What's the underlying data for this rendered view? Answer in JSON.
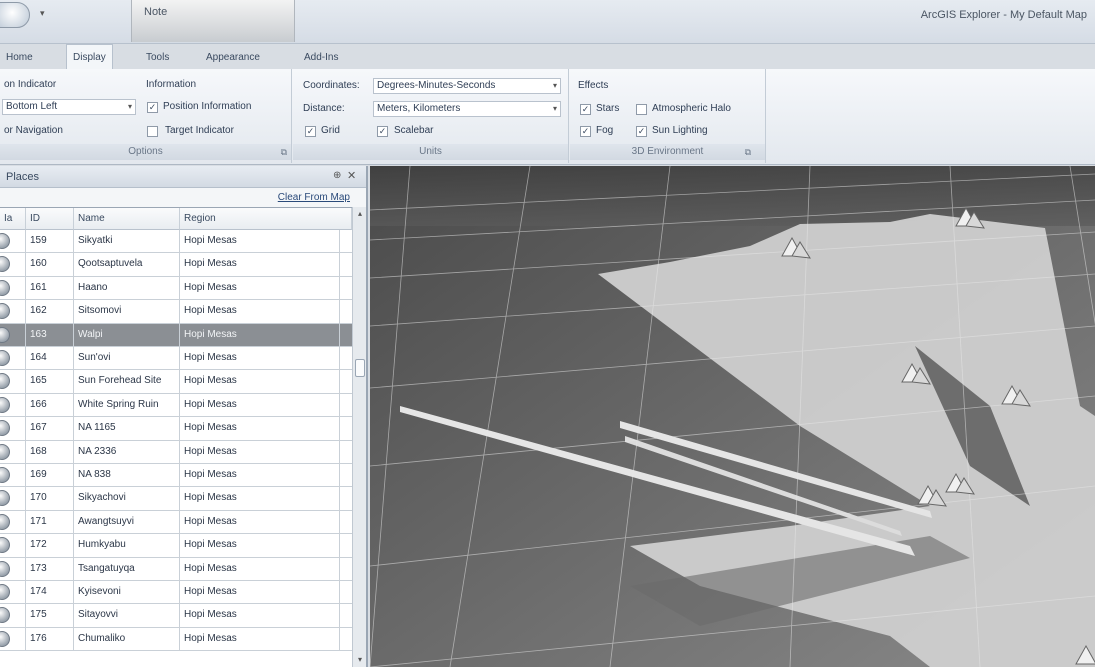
{
  "window": {
    "title": "ArcGIS Explorer - My Default Map"
  },
  "context_tab": "Note",
  "tabs": [
    "Home",
    "Display",
    "Tools",
    "Appearance",
    "Add-Ins"
  ],
  "active_tab": "Display",
  "ribbon": {
    "options": {
      "label": "Options",
      "partial_heading": "on Indicator",
      "combo_value": "Bottom Left",
      "partial_nav": "or Navigation",
      "info_heading": "Information",
      "position_info": {
        "label": "Position Information",
        "checked": true
      },
      "target_indicator": {
        "label": "Target Indicator",
        "checked": false
      }
    },
    "units": {
      "label": "Units",
      "coordinates_label": "Coordinates:",
      "coordinates_value": "Degrees-Minutes-Seconds",
      "distance_label": "Distance:",
      "distance_value": "Meters, Kilometers",
      "grid": {
        "label": "Grid",
        "checked": true
      },
      "scalebar": {
        "label": "Scalebar",
        "checked": true
      }
    },
    "environment": {
      "label": "3D Environment",
      "effects_heading": "Effects",
      "stars": {
        "label": "Stars",
        "checked": true
      },
      "atmospheric_halo": {
        "label": "Atmospheric Halo",
        "checked": false
      },
      "fog": {
        "label": "Fog",
        "checked": true
      },
      "sun_lighting": {
        "label": "Sun Lighting",
        "checked": true
      }
    }
  },
  "panel": {
    "title": "Places",
    "clear_link": "Clear From Map",
    "columns": [
      "ID",
      "Name",
      "Region"
    ],
    "rows": [
      {
        "id": "159",
        "name": "Sikyatki",
        "region": "Hopi Mesas"
      },
      {
        "id": "160",
        "name": "Qootsaptuvela",
        "region": "Hopi Mesas"
      },
      {
        "id": "161",
        "name": "Haano",
        "region": "Hopi Mesas"
      },
      {
        "id": "162",
        "name": "Sitsomovi",
        "region": "Hopi Mesas"
      },
      {
        "id": "163",
        "name": "Walpi",
        "region": "Hopi Mesas"
      },
      {
        "id": "164",
        "name": "Sun'ovi",
        "region": "Hopi Mesas"
      },
      {
        "id": "165",
        "name": "Sun Forehead Site",
        "region": "Hopi Mesas"
      },
      {
        "id": "166",
        "name": "White Spring Ruin",
        "region": "Hopi Mesas"
      },
      {
        "id": "167",
        "name": "NA 1165",
        "region": "Hopi Mesas"
      },
      {
        "id": "168",
        "name": "NA 2336",
        "region": "Hopi Mesas"
      },
      {
        "id": "169",
        "name": "NA 838",
        "region": "Hopi Mesas"
      },
      {
        "id": "170",
        "name": "Sikyachovi",
        "region": "Hopi Mesas"
      },
      {
        "id": "171",
        "name": "Awangtsuyvi",
        "region": "Hopi Mesas"
      },
      {
        "id": "172",
        "name": "Humkyabu",
        "region": "Hopi Mesas"
      },
      {
        "id": "173",
        "name": "Tsangatuyqa",
        "region": "Hopi Mesas"
      },
      {
        "id": "174",
        "name": "Kyisevoni",
        "region": "Hopi Mesas"
      },
      {
        "id": "175",
        "name": "Sitayovvi",
        "region": "Hopi Mesas"
      },
      {
        "id": "176",
        "name": "Chumaliko",
        "region": "Hopi Mesas"
      }
    ],
    "selected_row": 4
  }
}
